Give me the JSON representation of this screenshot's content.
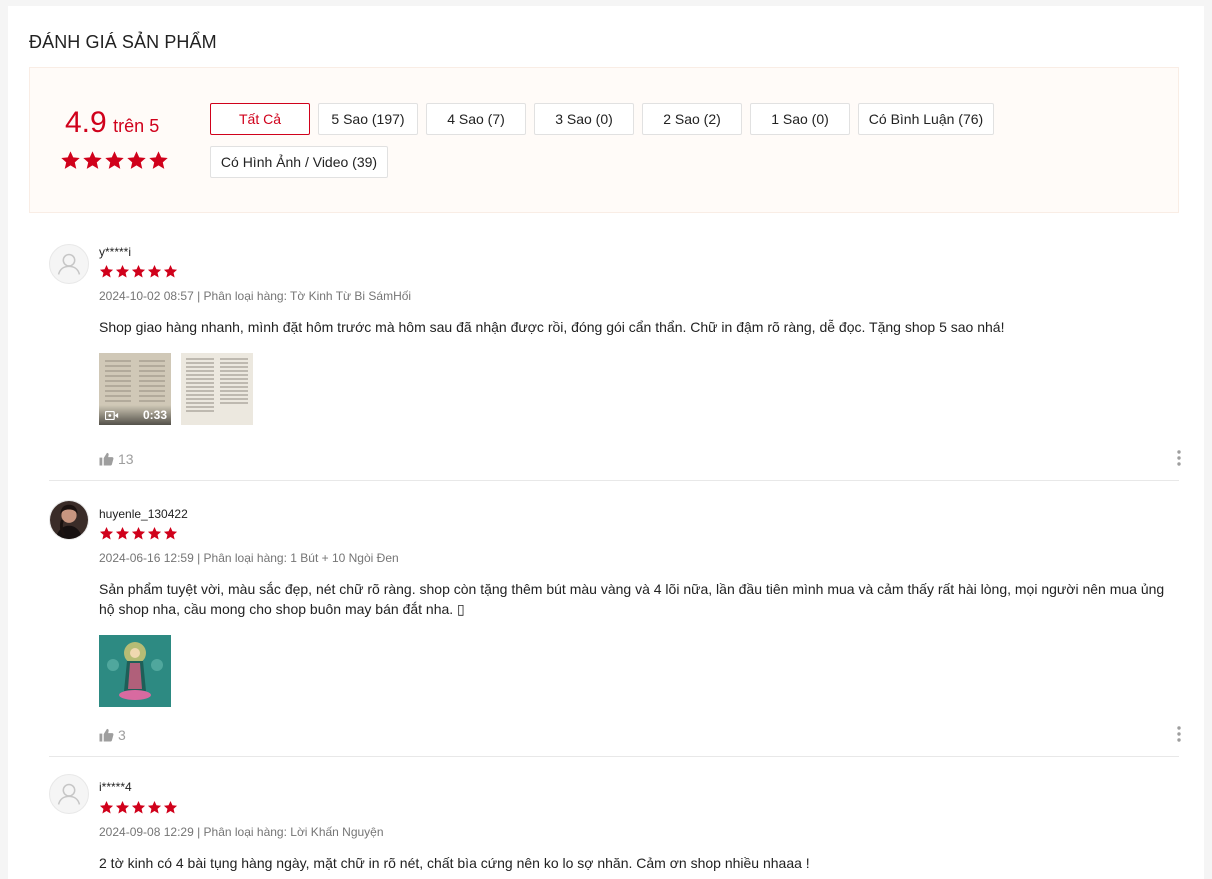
{
  "section_title": "ĐÁNH GIÁ SẢN PHẨM",
  "rating": {
    "score": "4.9",
    "suffix": "trên 5",
    "stars": 5
  },
  "filters": [
    {
      "label": "Tất Cả",
      "active": true
    },
    {
      "label": "5 Sao (197)",
      "active": false
    },
    {
      "label": "4 Sao (7)",
      "active": false
    },
    {
      "label": "3 Sao (0)",
      "active": false
    },
    {
      "label": "2 Sao (2)",
      "active": false
    },
    {
      "label": "1 Sao (0)",
      "active": false
    },
    {
      "label": "Có Bình Luận (76)",
      "active": false
    },
    {
      "label": "Có Hình Ảnh / Video (39)",
      "active": false
    }
  ],
  "colors": {
    "accent": "#d0011b",
    "muted": "#757575",
    "like": "#9e9e9e"
  },
  "icons": {
    "star": "star-icon",
    "like": "thumbs-up-icon",
    "more": "more-vertical-icon",
    "video": "video-camera-icon"
  },
  "reviews": [
    {
      "username": "y*****i",
      "stars": 5,
      "meta": "2024-10-02 08:57 | Phân loại hàng: Tờ Kinh Từ Bi SámHối",
      "text": "Shop giao hàng nhanh, mình đặt hôm trước mà hôm sau đã nhận được rồi,  đóng gói cẩn thẩn. Chữ in đậm rõ ràng, dễ đọc. Tặng shop 5 sao nhá!",
      "video_duration": "0:33",
      "likes": "13"
    },
    {
      "username": "huyenle_130422",
      "stars": 5,
      "meta": "2024-06-16 12:59 | Phân loại hàng: 1 Bút + 10 Ngòi Đen",
      "text": "Sản phẩm tuyệt vời, màu sắc đẹp, nét chữ rõ ràng. shop còn tặng thêm bút màu vàng và 4 lõi nữa, lần đầu tiên mình mua và cảm thấy rất hài lòng, mọi người nên mua ủng hộ shop nha, cầu mong cho shop buôn may bán đắt nha. ▯",
      "likes": "3"
    },
    {
      "username": "i*****4",
      "stars": 5,
      "meta": "2024-09-08 12:29 | Phân loại hàng: Lời Khấn Nguyện",
      "text": "2 tờ kinh có 4 bài tụng hàng ngày, mặt chữ in  rõ nét, chất bìa cứng nên ko lo sợ nhăn. Cảm ơn shop nhiều nhaaa !"
    }
  ]
}
